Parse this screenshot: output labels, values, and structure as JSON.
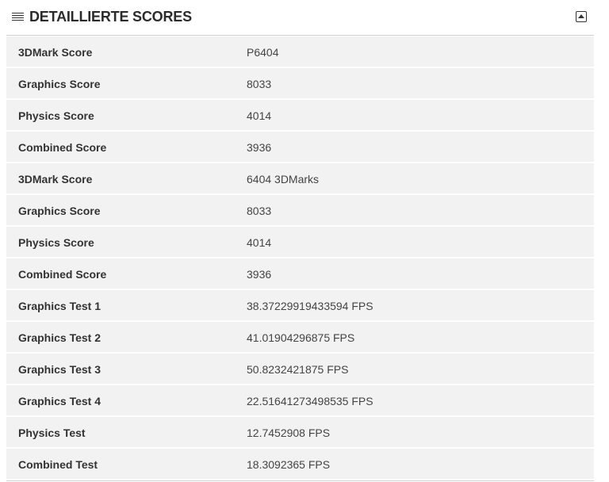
{
  "header": {
    "title": "DETAILLIERTE SCORES",
    "menu_icon": "hamburger-icon",
    "collapse_icon": "collapse-up-icon"
  },
  "rows": [
    {
      "label": "3DMark Score",
      "value": "P6404"
    },
    {
      "label": "Graphics Score",
      "value": "8033"
    },
    {
      "label": "Physics Score",
      "value": "4014"
    },
    {
      "label": "Combined Score",
      "value": "3936"
    },
    {
      "label": "3DMark Score",
      "value": "6404 3DMarks"
    },
    {
      "label": "Graphics Score",
      "value": "8033"
    },
    {
      "label": "Physics Score",
      "value": "4014"
    },
    {
      "label": "Combined Score",
      "value": "3936"
    },
    {
      "label": "Graphics Test 1",
      "value": "38.37229919433594 FPS"
    },
    {
      "label": "Graphics Test 2",
      "value": "41.01904296875 FPS"
    },
    {
      "label": "Graphics Test 3",
      "value": "50.8232421875 FPS"
    },
    {
      "label": "Graphics Test 4",
      "value": "22.51641273498535 FPS"
    },
    {
      "label": "Physics Test",
      "value": "12.7452908 FPS"
    },
    {
      "label": "Combined Test",
      "value": "18.3092365 FPS"
    }
  ]
}
